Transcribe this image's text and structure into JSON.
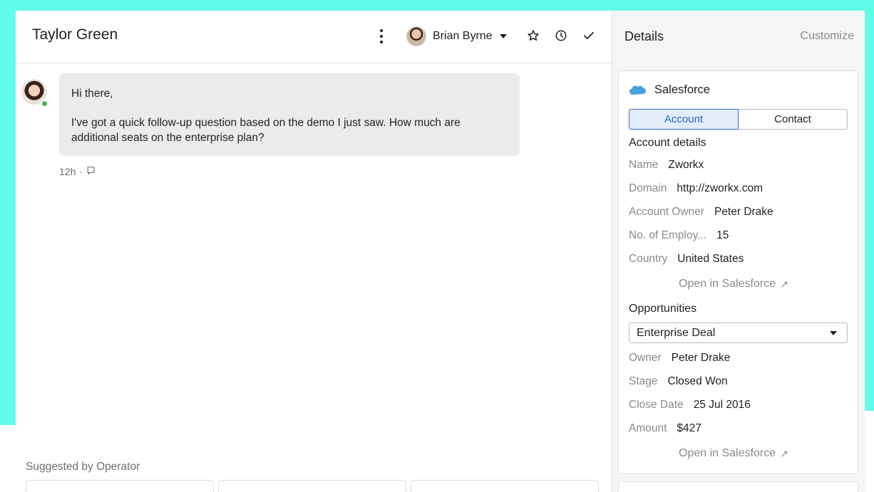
{
  "conversation": {
    "title": "Taylor Green",
    "assignee": "Brian Byrne",
    "message": {
      "line1": "Hi there,",
      "line2": "I've got a quick follow-up question based on the demo I just saw. How much are additional seats on the enterprise plan?",
      "time": "12h",
      "separator": "·"
    },
    "suggested_title": "Suggested by Operator"
  },
  "details": {
    "title": "Details",
    "customize": "Customize",
    "integration": "Salesforce",
    "tabs": [
      "Account",
      "Contact"
    ],
    "account_heading": "Account details",
    "account_fields": [
      {
        "key": "Name",
        "value": "Zworkx"
      },
      {
        "key": "Domain",
        "value": "http://zworkx.com"
      },
      {
        "key": "Account Owner",
        "value": "Peter Drake"
      },
      {
        "key": "No. of Employ...",
        "value": "15"
      },
      {
        "key": "Country",
        "value": "United States"
      }
    ],
    "open_link": "Open in Salesforce",
    "open_arrow": "↗",
    "opportunities_heading": "Opportunities",
    "opportunity_selected": "Enterprise Deal",
    "opportunity_fields": [
      {
        "key": "Owner",
        "value": "Peter Drake"
      },
      {
        "key": "Stage",
        "value": "Closed Won"
      },
      {
        "key": "Close Date",
        "value": "25 Jul 2016"
      },
      {
        "key": "Amount",
        "value": "$427"
      }
    ]
  },
  "colors": {
    "background": "#63fbeb",
    "accent": "#2c65c4",
    "online": "#4caf50",
    "bubble": "#ebebeb"
  }
}
